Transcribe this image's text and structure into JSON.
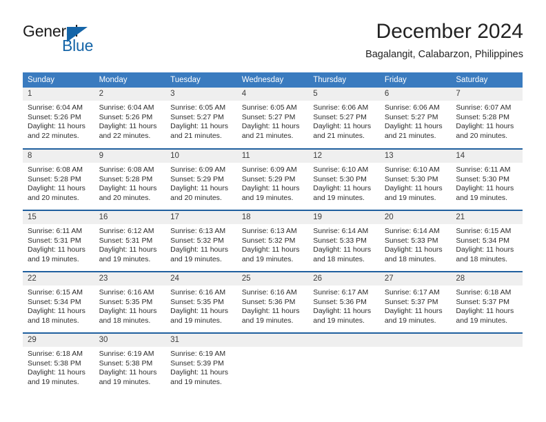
{
  "logo": {
    "text_primary": "General",
    "text_secondary": "Blue",
    "triangle_color": "#1565a8",
    "primary_color": "#1b1b1b"
  },
  "header": {
    "title": "December 2024",
    "subtitle": "Bagalangit, Calabarzon, Philippines"
  },
  "theme": {
    "header_row_bg": "#3a7bbf",
    "week_separator": "#1f5f9e",
    "daynum_bg": "#efefef"
  },
  "weekday_headers": [
    "Sunday",
    "Monday",
    "Tuesday",
    "Wednesday",
    "Thursday",
    "Friday",
    "Saturday"
  ],
  "weeks": [
    [
      {
        "day": "1",
        "sunrise": "Sunrise: 6:04 AM",
        "sunset": "Sunset: 5:26 PM",
        "daylight_1": "Daylight: 11 hours",
        "daylight_2": "and 22 minutes."
      },
      {
        "day": "2",
        "sunrise": "Sunrise: 6:04 AM",
        "sunset": "Sunset: 5:26 PM",
        "daylight_1": "Daylight: 11 hours",
        "daylight_2": "and 22 minutes."
      },
      {
        "day": "3",
        "sunrise": "Sunrise: 6:05 AM",
        "sunset": "Sunset: 5:27 PM",
        "daylight_1": "Daylight: 11 hours",
        "daylight_2": "and 21 minutes."
      },
      {
        "day": "4",
        "sunrise": "Sunrise: 6:05 AM",
        "sunset": "Sunset: 5:27 PM",
        "daylight_1": "Daylight: 11 hours",
        "daylight_2": "and 21 minutes."
      },
      {
        "day": "5",
        "sunrise": "Sunrise: 6:06 AM",
        "sunset": "Sunset: 5:27 PM",
        "daylight_1": "Daylight: 11 hours",
        "daylight_2": "and 21 minutes."
      },
      {
        "day": "6",
        "sunrise": "Sunrise: 6:06 AM",
        "sunset": "Sunset: 5:27 PM",
        "daylight_1": "Daylight: 11 hours",
        "daylight_2": "and 21 minutes."
      },
      {
        "day": "7",
        "sunrise": "Sunrise: 6:07 AM",
        "sunset": "Sunset: 5:28 PM",
        "daylight_1": "Daylight: 11 hours",
        "daylight_2": "and 20 minutes."
      }
    ],
    [
      {
        "day": "8",
        "sunrise": "Sunrise: 6:08 AM",
        "sunset": "Sunset: 5:28 PM",
        "daylight_1": "Daylight: 11 hours",
        "daylight_2": "and 20 minutes."
      },
      {
        "day": "9",
        "sunrise": "Sunrise: 6:08 AM",
        "sunset": "Sunset: 5:28 PM",
        "daylight_1": "Daylight: 11 hours",
        "daylight_2": "and 20 minutes."
      },
      {
        "day": "10",
        "sunrise": "Sunrise: 6:09 AM",
        "sunset": "Sunset: 5:29 PM",
        "daylight_1": "Daylight: 11 hours",
        "daylight_2": "and 20 minutes."
      },
      {
        "day": "11",
        "sunrise": "Sunrise: 6:09 AM",
        "sunset": "Sunset: 5:29 PM",
        "daylight_1": "Daylight: 11 hours",
        "daylight_2": "and 19 minutes."
      },
      {
        "day": "12",
        "sunrise": "Sunrise: 6:10 AM",
        "sunset": "Sunset: 5:30 PM",
        "daylight_1": "Daylight: 11 hours",
        "daylight_2": "and 19 minutes."
      },
      {
        "day": "13",
        "sunrise": "Sunrise: 6:10 AM",
        "sunset": "Sunset: 5:30 PM",
        "daylight_1": "Daylight: 11 hours",
        "daylight_2": "and 19 minutes."
      },
      {
        "day": "14",
        "sunrise": "Sunrise: 6:11 AM",
        "sunset": "Sunset: 5:30 PM",
        "daylight_1": "Daylight: 11 hours",
        "daylight_2": "and 19 minutes."
      }
    ],
    [
      {
        "day": "15",
        "sunrise": "Sunrise: 6:11 AM",
        "sunset": "Sunset: 5:31 PM",
        "daylight_1": "Daylight: 11 hours",
        "daylight_2": "and 19 minutes."
      },
      {
        "day": "16",
        "sunrise": "Sunrise: 6:12 AM",
        "sunset": "Sunset: 5:31 PM",
        "daylight_1": "Daylight: 11 hours",
        "daylight_2": "and 19 minutes."
      },
      {
        "day": "17",
        "sunrise": "Sunrise: 6:13 AM",
        "sunset": "Sunset: 5:32 PM",
        "daylight_1": "Daylight: 11 hours",
        "daylight_2": "and 19 minutes."
      },
      {
        "day": "18",
        "sunrise": "Sunrise: 6:13 AM",
        "sunset": "Sunset: 5:32 PM",
        "daylight_1": "Daylight: 11 hours",
        "daylight_2": "and 19 minutes."
      },
      {
        "day": "19",
        "sunrise": "Sunrise: 6:14 AM",
        "sunset": "Sunset: 5:33 PM",
        "daylight_1": "Daylight: 11 hours",
        "daylight_2": "and 18 minutes."
      },
      {
        "day": "20",
        "sunrise": "Sunrise: 6:14 AM",
        "sunset": "Sunset: 5:33 PM",
        "daylight_1": "Daylight: 11 hours",
        "daylight_2": "and 18 minutes."
      },
      {
        "day": "21",
        "sunrise": "Sunrise: 6:15 AM",
        "sunset": "Sunset: 5:34 PM",
        "daylight_1": "Daylight: 11 hours",
        "daylight_2": "and 18 minutes."
      }
    ],
    [
      {
        "day": "22",
        "sunrise": "Sunrise: 6:15 AM",
        "sunset": "Sunset: 5:34 PM",
        "daylight_1": "Daylight: 11 hours",
        "daylight_2": "and 18 minutes."
      },
      {
        "day": "23",
        "sunrise": "Sunrise: 6:16 AM",
        "sunset": "Sunset: 5:35 PM",
        "daylight_1": "Daylight: 11 hours",
        "daylight_2": "and 18 minutes."
      },
      {
        "day": "24",
        "sunrise": "Sunrise: 6:16 AM",
        "sunset": "Sunset: 5:35 PM",
        "daylight_1": "Daylight: 11 hours",
        "daylight_2": "and 19 minutes."
      },
      {
        "day": "25",
        "sunrise": "Sunrise: 6:16 AM",
        "sunset": "Sunset: 5:36 PM",
        "daylight_1": "Daylight: 11 hours",
        "daylight_2": "and 19 minutes."
      },
      {
        "day": "26",
        "sunrise": "Sunrise: 6:17 AM",
        "sunset": "Sunset: 5:36 PM",
        "daylight_1": "Daylight: 11 hours",
        "daylight_2": "and 19 minutes."
      },
      {
        "day": "27",
        "sunrise": "Sunrise: 6:17 AM",
        "sunset": "Sunset: 5:37 PM",
        "daylight_1": "Daylight: 11 hours",
        "daylight_2": "and 19 minutes."
      },
      {
        "day": "28",
        "sunrise": "Sunrise: 6:18 AM",
        "sunset": "Sunset: 5:37 PM",
        "daylight_1": "Daylight: 11 hours",
        "daylight_2": "and 19 minutes."
      }
    ],
    [
      {
        "day": "29",
        "sunrise": "Sunrise: 6:18 AM",
        "sunset": "Sunset: 5:38 PM",
        "daylight_1": "Daylight: 11 hours",
        "daylight_2": "and 19 minutes."
      },
      {
        "day": "30",
        "sunrise": "Sunrise: 6:19 AM",
        "sunset": "Sunset: 5:38 PM",
        "daylight_1": "Daylight: 11 hours",
        "daylight_2": "and 19 minutes."
      },
      {
        "day": "31",
        "sunrise": "Sunrise: 6:19 AM",
        "sunset": "Sunset: 5:39 PM",
        "daylight_1": "Daylight: 11 hours",
        "daylight_2": "and 19 minutes."
      },
      {
        "day": "",
        "sunrise": "",
        "sunset": "",
        "daylight_1": "",
        "daylight_2": ""
      },
      {
        "day": "",
        "sunrise": "",
        "sunset": "",
        "daylight_1": "",
        "daylight_2": ""
      },
      {
        "day": "",
        "sunrise": "",
        "sunset": "",
        "daylight_1": "",
        "daylight_2": ""
      },
      {
        "day": "",
        "sunrise": "",
        "sunset": "",
        "daylight_1": "",
        "daylight_2": ""
      }
    ]
  ]
}
